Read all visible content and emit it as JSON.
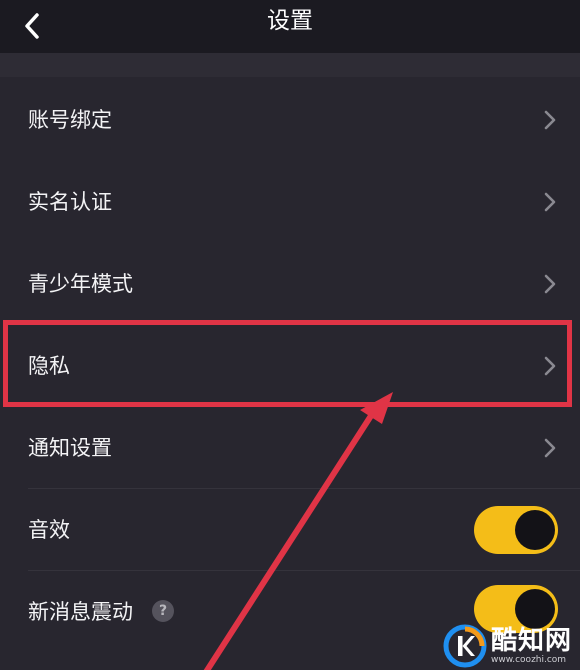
{
  "header": {
    "title": "设置",
    "back_icon": "chevron-left-icon"
  },
  "settings": {
    "items": [
      {
        "label": "账号绑定",
        "control": "chevron"
      },
      {
        "label": "实名认证",
        "control": "chevron"
      },
      {
        "label": "青少年模式",
        "control": "chevron"
      },
      {
        "label": "隐私",
        "control": "chevron",
        "highlighted": true
      },
      {
        "label": "通知设置",
        "control": "chevron"
      },
      {
        "label": "音效",
        "control": "toggle",
        "state": "on"
      },
      {
        "label": "新消息震动",
        "control": "toggle",
        "state": "on",
        "help_icon": "?"
      }
    ]
  },
  "annotation": {
    "highlight_color": "#e03446",
    "arrow_color": "#e03446",
    "target": "隐私"
  },
  "watermark": {
    "name": "酷知网",
    "url": "www.coozhi.com"
  },
  "colors": {
    "background": "#28262f",
    "header": "#1b1a21",
    "toggle_on": "#f4bd18",
    "text": "#f3f3f5"
  }
}
